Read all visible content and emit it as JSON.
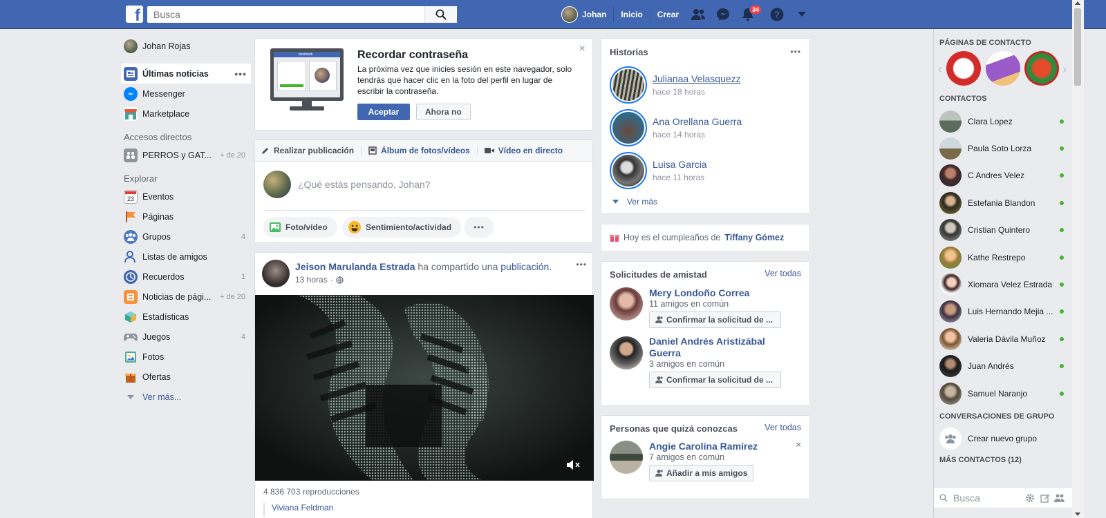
{
  "topbar": {
    "search_placeholder": "Busca",
    "user_name": "Johan",
    "home_label": "Inicio",
    "create_label": "Crear",
    "notification_count": "34"
  },
  "leftnav": {
    "profile_name": "Johan Rojas",
    "items": [
      {
        "label": "Últimas noticias"
      },
      {
        "label": "Messenger"
      },
      {
        "label": "Marketplace"
      }
    ],
    "shortcuts_heading": "Accesos directos",
    "shortcut": {
      "label": "PERROS y GAT...",
      "count": "+ de 20"
    },
    "explore_heading": "Explorar",
    "explore": [
      {
        "label": "Eventos",
        "count": ""
      },
      {
        "label": "Páginas",
        "count": ""
      },
      {
        "label": "Grupos",
        "count": "4"
      },
      {
        "label": "Listas de amigos",
        "count": ""
      },
      {
        "label": "Recuerdos",
        "count": "1"
      },
      {
        "label": "Noticias de pági...",
        "count": "+ de 20"
      },
      {
        "label": "Estadísticas",
        "count": ""
      },
      {
        "label": "Juegos",
        "count": "4"
      },
      {
        "label": "Fotos",
        "count": ""
      },
      {
        "label": "Ofertas",
        "count": ""
      }
    ],
    "see_more": "Ver más..."
  },
  "password_card": {
    "title": "Recordar contraseña",
    "body": "La próxima vez que inicies sesión en este navegador, solo tendrás que hacer clic en la foto del perfil en lugar de escribir la contraseña.",
    "accept": "Aceptar",
    "decline": "Ahora no",
    "monitor_logo": "facebook"
  },
  "composer": {
    "tabs": [
      "Realizar publicación",
      "Álbum de fotos/vídeos",
      "Vídeo en directo"
    ],
    "placeholder": "¿Qué estás pensando, Johan?",
    "actions": [
      "Foto/vídeo",
      "Sentimiento/actividad"
    ]
  },
  "post": {
    "author": "Jeison Marulanda Estrada",
    "shared_text": "ha compartido una",
    "shared_link": "publicación.",
    "time": "13 horas",
    "views": "4 836 703 reproducciones",
    "next_author_partial": "Viviana Feldman"
  },
  "stories": {
    "title": "Historias",
    "items": [
      {
        "name": "Julianaa Velasquezz",
        "time": "hace 18 horas"
      },
      {
        "name": "Ana Orellana Guerra",
        "time": "hace 14 horas"
      },
      {
        "name": "Luisa Garcia",
        "time": "hace 11 horas"
      }
    ],
    "see_more": "Ver más"
  },
  "birthday": {
    "text": "Hoy es el cumpleaños de",
    "name": "Tiffany Gómez"
  },
  "friend_requests": {
    "title": "Solicitudes de amistad",
    "see_all": "Ver todas",
    "items": [
      {
        "name": "Mery Londoño Correa",
        "mutual": "11 amigos en común",
        "action": "Confirmar la solicitud de ..."
      },
      {
        "name": "Daniel Andrés Aristizábal Guerra",
        "mutual": "3 amigos en común",
        "action": "Confirmar la solicitud de ..."
      }
    ]
  },
  "people_you_may_know": {
    "title": "Personas que quizá conozcas",
    "see_all": "Ver todas",
    "name": "Angie Carolina Ramírez",
    "mutual": "7 amigos en común",
    "action": "Añadir a mis amigos"
  },
  "chat": {
    "pages_heading": "PÁGINAS DE CONTACTO",
    "contacts_heading": "CONTACTOS",
    "contacts": [
      "Clara Lopez",
      "Paula Soto Lorza",
      "C Andres Velez",
      "Estefania Blandon",
      "Cristian Quintero",
      "Kathe Restrepo",
      "Xiomara Velez Estrada",
      "Luis Hernando Mejia ...",
      "Valeria Dávila Muñoz",
      "Juan Andrés",
      "Samuel Naranjo"
    ],
    "group_heading": "CONVERSACIONES DE GRUPO",
    "create_group": "Crear nuevo grupo",
    "more_contacts": "MÁS CONTACTOS (12)",
    "search_placeholder": "Busca"
  },
  "colors": {
    "brand_blue": "#4267b2",
    "link_blue": "#385898",
    "online_green": "#42b72a",
    "notification_red": "#fa3e3e"
  }
}
